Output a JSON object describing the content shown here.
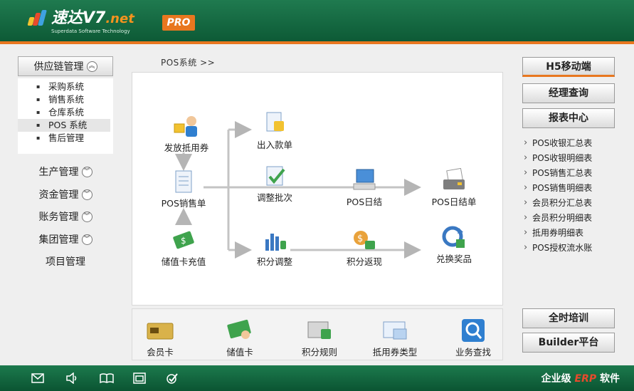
{
  "header": {
    "brand": "速达V7",
    "brand_suffix": ".net",
    "tagline": "Superdata Software Technology",
    "pro_badge": "PRO"
  },
  "sidebar": {
    "active_group": "供应链管理",
    "sub_items": [
      {
        "label": "采购系统"
      },
      {
        "label": "销售系统"
      },
      {
        "label": "仓库系统"
      },
      {
        "label": "POS 系统",
        "active": true
      },
      {
        "label": "售后管理"
      }
    ],
    "groups": [
      {
        "label": "生产管理"
      },
      {
        "label": "资金管理"
      },
      {
        "label": "账务管理"
      },
      {
        "label": "集团管理"
      },
      {
        "label": "项目管理"
      }
    ]
  },
  "breadcrumb": "POS系统 >>",
  "flow": {
    "issue_voucher": "发放抵用券",
    "pos_sales": "POS销售单",
    "card_recharge": "储值卡充值",
    "in_out_payment": "出入款单",
    "adjust_batch": "调整批次",
    "points_adjust": "积分调整",
    "pos_daily": "POS日结",
    "points_return": "积分返现",
    "pos_daily_order": "POS日结单",
    "redeem_prize": "兑换奖品"
  },
  "quickbar": [
    {
      "label": "会员卡",
      "icon": "member-card-icon"
    },
    {
      "label": "储值卡",
      "icon": "stored-value-card-icon"
    },
    {
      "label": "积分规则",
      "icon": "points-rule-icon"
    },
    {
      "label": "抵用券类型",
      "icon": "voucher-type-icon"
    },
    {
      "label": "业务查找",
      "icon": "search-icon"
    }
  ],
  "right": {
    "h5_label": "H5移动端",
    "manager_query": "经理查询",
    "report_center": "报表中心",
    "reports": [
      "POS收银汇总表",
      "POS收银明细表",
      "POS销售汇总表",
      "POS销售明细表",
      "会员积分汇总表",
      "会员积分明细表",
      "抵用券明细表",
      "POS授权流水账"
    ],
    "training": "全时培训",
    "builder": "Builder平台"
  },
  "footer": {
    "brand_prefix": "企业级",
    "brand_erp": "ERP",
    "brand_suffix": "软件",
    "icons": [
      "mail-icon",
      "volume-icon",
      "book-icon",
      "window-icon",
      "check-icon"
    ]
  },
  "colors": {
    "header_green": "#136b43",
    "accent_orange": "#e8771f"
  }
}
